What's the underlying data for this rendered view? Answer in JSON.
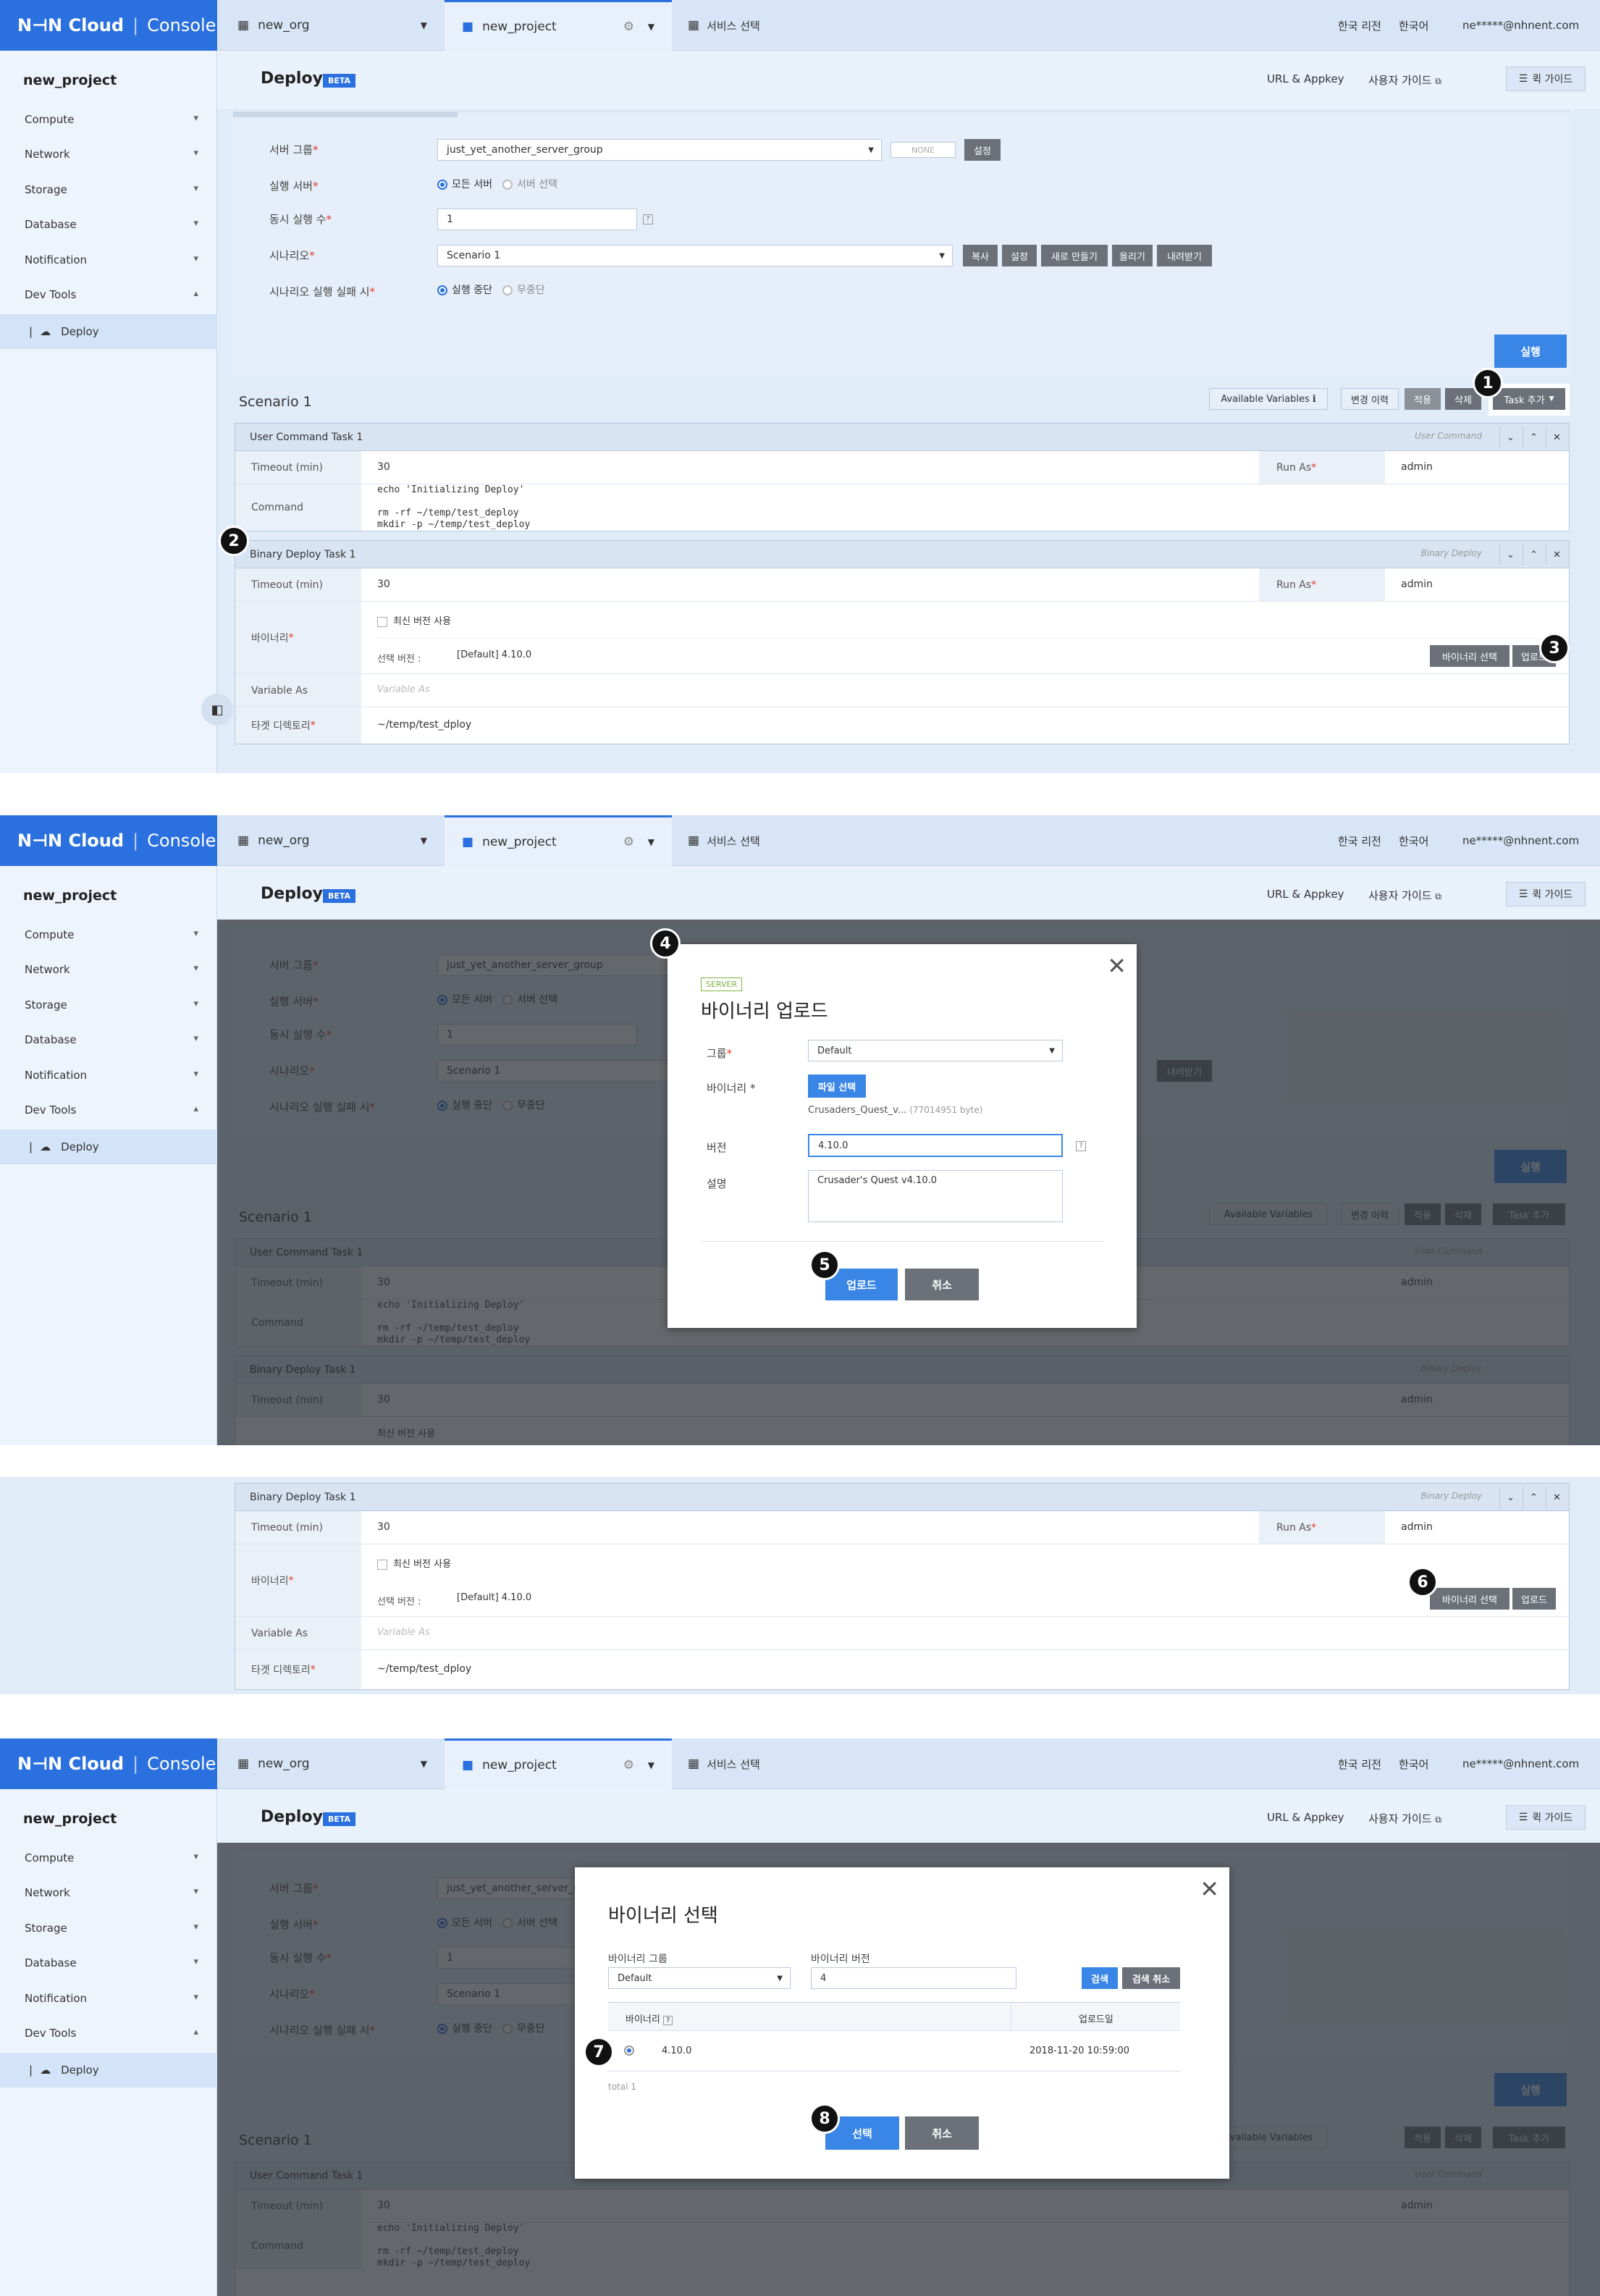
{
  "topbar": {
    "logo_brand": "N⊣N Cloud",
    "logo_console": "Console",
    "org_tab": "new_org",
    "project_tab": "new_project",
    "service_tab": "서비스 선택",
    "region": "한국 리전",
    "language": "한국어",
    "user": "ne*****@nhnent.com"
  },
  "sidebar": {
    "project": "new_project",
    "items": [
      "Compute",
      "Network",
      "Storage",
      "Database",
      "Notification",
      "Dev Tools"
    ],
    "sub_item": "Deploy"
  },
  "header": {
    "title": "Deploy",
    "beta": "BETA",
    "url_appkey": "URL & Appkey",
    "user_guide": "사용자 가이드",
    "quick_guide": "퀵 가이드"
  },
  "form": {
    "server_group_label": "서버 그룹",
    "server_group_value": "just_yet_another_server_group",
    "none_label": "NONE",
    "settings_btn": "설정",
    "exec_server_label": "실행 서버",
    "all_servers": "모든 서버",
    "select_server": "서버 선택",
    "concurrent_label": "동시 실행 수",
    "concurrent_value": "1",
    "scenario_label": "시나리오",
    "scenario_value": "Scenario 1",
    "scenario_btns": [
      "복사",
      "설정",
      "새로 만들기",
      "올리기",
      "내려받기"
    ],
    "on_fail_label": "시나리오 실행 실패 시",
    "stop": "실행 중단",
    "ignore": "무중단",
    "run_btn": "실행"
  },
  "scenario": {
    "title": "Scenario 1",
    "available_vars": "Available Variables",
    "change_history": "변경 이력",
    "apply": "적용",
    "delete": "삭제",
    "add_task": "Task 추가"
  },
  "task1": {
    "name": "User Command Task 1",
    "type": "User Command",
    "timeout_label": "Timeout (min)",
    "timeout": "30",
    "run_as_label": "Run As",
    "run_as": "admin",
    "command_label": "Command",
    "command": "echo 'Initializing Deploy'\n\nrm -rf ~/temp/test_deploy\nmkdir -p ~/temp/test_deploy"
  },
  "task2": {
    "name": "Binary Deploy Task 1",
    "type": "Binary Deploy",
    "timeout_label": "Timeout (min)",
    "timeout": "30",
    "run_as_label": "Run As",
    "run_as": "admin",
    "binary_label": "바이너리",
    "use_latest": "최신 버전 사용",
    "selected_version_label": "선택 버전 :",
    "selected_version": "[Default] 4.10.0",
    "select_binary_btn": "바이너리 선택",
    "upload_btn": "업로드",
    "variable_as_label": "Variable As",
    "variable_as_placeholder": "Variable As",
    "target_dir_label": "타겟 디렉토리",
    "target_dir": "~/temp/test_dploy"
  },
  "upload_modal": {
    "tag": "SERVER",
    "title": "바이너리 업로드",
    "group_label": "그룹",
    "group_value": "Default",
    "binary_label": "바이너리 *",
    "file_btn": "파일 선택",
    "file_name": "Crusaders_Quest_v...",
    "file_size": "(77014951 byte)",
    "version_label": "버전",
    "version_value": "4.10.0",
    "desc_label": "설명",
    "desc_value": "Crusader's Quest v4.10.0",
    "upload_btn": "업로드",
    "cancel_btn": "취소"
  },
  "select_modal": {
    "title": "바이너리 선택",
    "group_label": "바이너리 그룹",
    "group_value": "Default",
    "version_label": "바이너리 버전",
    "version_value": "4",
    "search_btn": "검색",
    "search_cancel_btn": "검색 취소",
    "col_binary": "바이너리",
    "col_uploaded": "업로드일",
    "rows": [
      {
        "version": "4.10.0",
        "date": "2018-11-20 10:59:00"
      }
    ],
    "total": "total 1",
    "select_btn": "선택",
    "cancel_btn": "취소"
  },
  "badges": [
    "1",
    "2",
    "3",
    "4",
    "5",
    "6",
    "7",
    "8"
  ],
  "colors": {
    "primary": "#2a70de",
    "button_dark": "#6b7079",
    "required": "#e0382b"
  }
}
